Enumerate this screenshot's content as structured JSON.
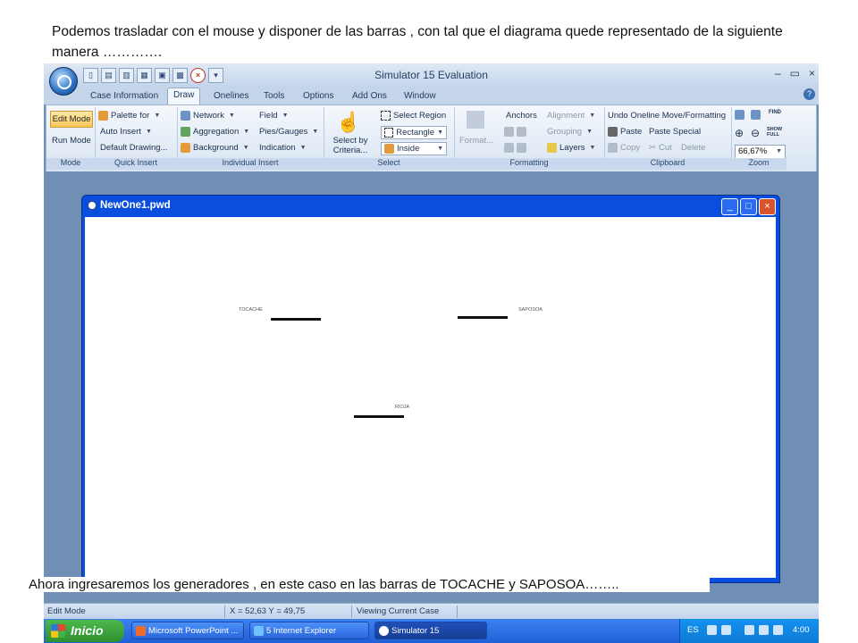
{
  "caption_top": "Podemos trasladar con el mouse y disponer de las barras , con tal que el diagrama quede representado de la siguiente manera ………….",
  "caption_bottom": "Ahora ingresaremos  los generadores , en este caso en las barras de   TOCACHE y SAPOSOA……..",
  "app": {
    "title": "Simulator 15 Evaluation",
    "window_controls": {
      "minimize": "–",
      "restore": "▭",
      "close": "×"
    }
  },
  "tabs": [
    "Case Information",
    "Draw",
    "Onelines",
    "Tools",
    "Options",
    "Add Ons",
    "Window"
  ],
  "active_tab": "Draw",
  "ribbon": {
    "mode": {
      "label": "Mode",
      "edit": "Edit Mode",
      "run": "Run Mode"
    },
    "quick_insert": {
      "label": "Quick Insert",
      "palette": "Palette for",
      "auto": "Auto Insert",
      "default": "Default Drawing..."
    },
    "individual_insert": {
      "label": "Individual Insert",
      "network": "Network",
      "aggregation": "Aggregation",
      "background": "Background",
      "field": "Field",
      "pies": "Pies/Gauges",
      "indication": "Indication"
    },
    "select": {
      "label": "Select",
      "by_criteria": "Select by Criteria...",
      "region": "Select Region",
      "rectangle": "Rectangle",
      "inside": "Inside"
    },
    "formatting": {
      "label": "Formatting",
      "format": "Format...",
      "anchors": "Anchors",
      "alignment": "Alignment",
      "grouping": "Grouping",
      "layers": "Layers"
    },
    "clipboard": {
      "label": "Clipboard",
      "undo": "Undo Oneline Move/Formatting",
      "paste": "Paste",
      "paste_special": "Paste Special",
      "copy": "Copy",
      "cut": "Cut",
      "delete": "Delete"
    },
    "zoom": {
      "label": "Zoom",
      "level": "66,67%",
      "find": "FIND",
      "show_full": "SHOW FULL"
    }
  },
  "document": {
    "title": "NewOne1.pwd",
    "buses": [
      {
        "name": "TOCACHE"
      },
      {
        "name": "SAPOSOA"
      },
      {
        "name": "RIOJA"
      }
    ]
  },
  "status_bar": {
    "mode": "Edit Mode",
    "coords": "X = 52,63 Y = 49,75",
    "view": "Viewing Current Case"
  },
  "taskbar": {
    "start": "Inicio",
    "items": [
      "Microsoft PowerPoint ...",
      "5 Internet Explorer",
      "Simulator 15"
    ],
    "lang": "ES",
    "clock": "4:00"
  }
}
